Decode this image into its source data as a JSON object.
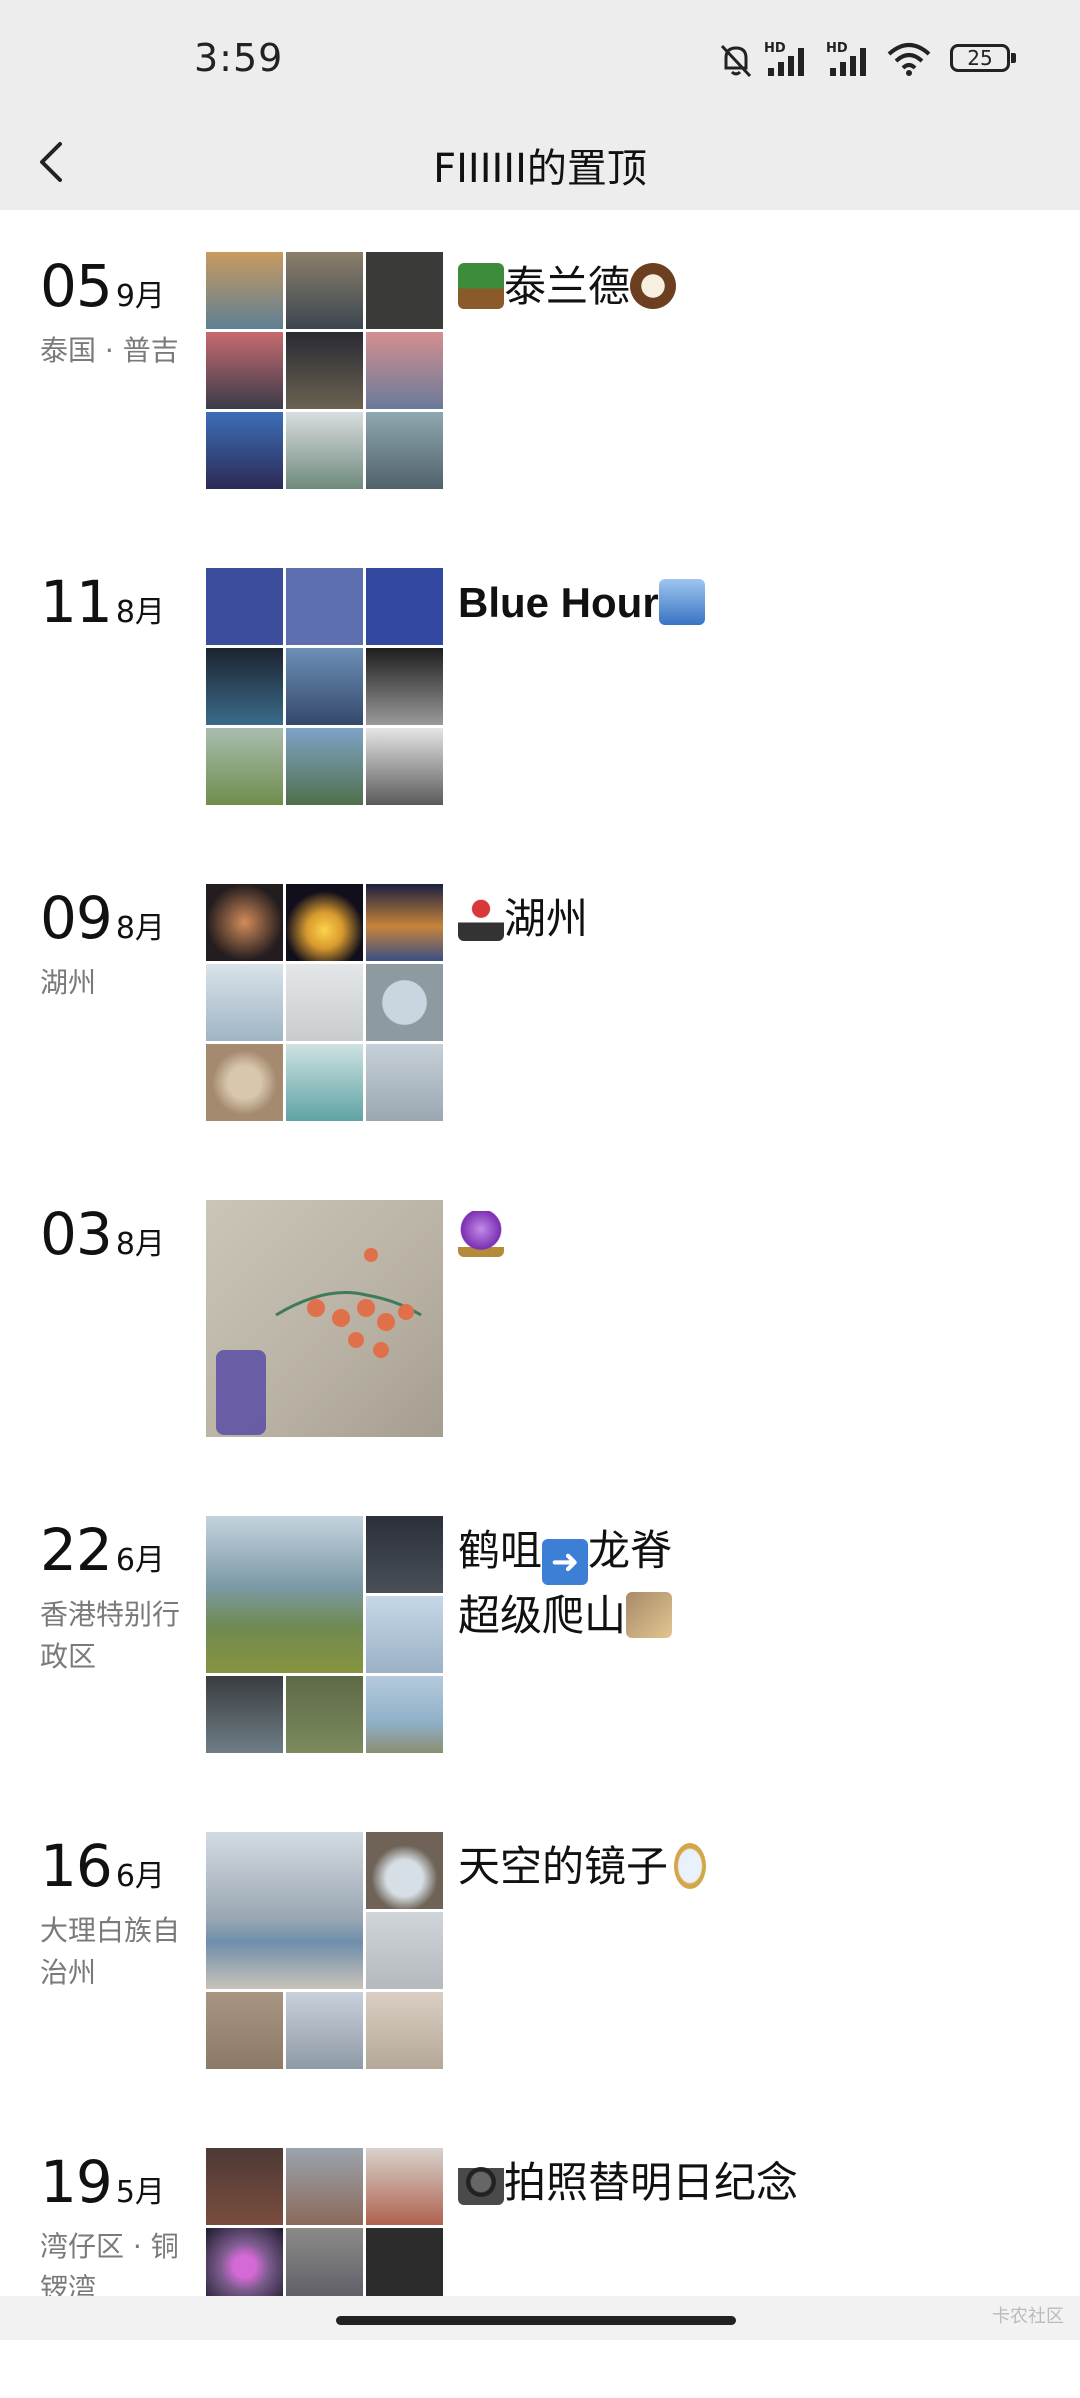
{
  "status_bar": {
    "time": "3:59",
    "icons": [
      "mute-bell-icon",
      "hd-signal-icon",
      "hd-signal-icon",
      "wifi-icon"
    ],
    "battery": "25"
  },
  "header": {
    "back_icon": "chevron-left-icon",
    "title": "FIIIIII的置顶"
  },
  "posts": [
    {
      "day": "05",
      "month": "9月",
      "location": "泰国 · 普吉",
      "caption": "泰兰德",
      "emoji_before": "palm-tree-icon",
      "emoji_after": "coconut-icon",
      "thumbs": [
        "#5f7f94",
        "#8a7f6a",
        "#3a3a38",
        "#c76a6f",
        "#3b3b46",
        "#d48f90",
        "#2c4a86",
        "#9aa8a0",
        "#50616a"
      ]
    },
    {
      "day": "11",
      "month": "8月",
      "location": "",
      "caption": "Blue Hour",
      "emoji_after": "city-icon",
      "thumbs": [
        "#3c4d9c",
        "#5d6fb0",
        "#3348a0",
        "#1d2430",
        "#6d8fb6",
        "#3a3a3a",
        "#6f8d4c",
        "#7fa3c8",
        "#cfcfcf"
      ]
    },
    {
      "day": "09",
      "month": "8月",
      "location": "湖州",
      "caption": "湖州",
      "emoji_before": "joystick-icon",
      "thumbs": [
        "#241d1f",
        "#d89a2f",
        "#3a4f86",
        "#9fb4c3",
        "#c9cccc",
        "#8d9aa0",
        "#a48a6f",
        "#5fa3a6",
        "#9aa7b1"
      ]
    },
    {
      "day": "03",
      "month": "8月",
      "location": "",
      "caption": "",
      "emoji_after": "crystal-ball-icon",
      "single_photo": "#b8b1a4"
    },
    {
      "day": "22",
      "month": "6月",
      "location": "香港特别行政区",
      "caption_lines": [
        "鹤咀",
        "龙脊",
        "超级爬山"
      ],
      "emojis": [
        "right-arrow-icon",
        "climber-icon"
      ],
      "thumbs": [
        "#7c9aa6",
        "#4a5058",
        "#9bb1c5",
        "#6e7e86",
        "#7c8a5e",
        "#8fb0c9"
      ]
    },
    {
      "day": "16",
      "month": "6月",
      "location": "大理白族自治州",
      "caption": "天空的镜子",
      "emoji_after": "mirror-icon",
      "thumbs": [
        "#9aa7b3",
        "#6e6356",
        "#b3b9bd",
        "#8b7a66",
        "#8e9aa6",
        "#b4a898"
      ]
    },
    {
      "day": "19",
      "month": "5月",
      "location": "湾仔区 · 铜锣湾",
      "caption": "拍照替明日纪念",
      "emoji_before": "camera-icon",
      "thumbs": [
        "#4e3a36",
        "#8c6a5a",
        "#b0624e",
        "#7a5b8c",
        "#5b5b66",
        "#2c2c2c"
      ]
    }
  ],
  "watermark": "卡农社区"
}
